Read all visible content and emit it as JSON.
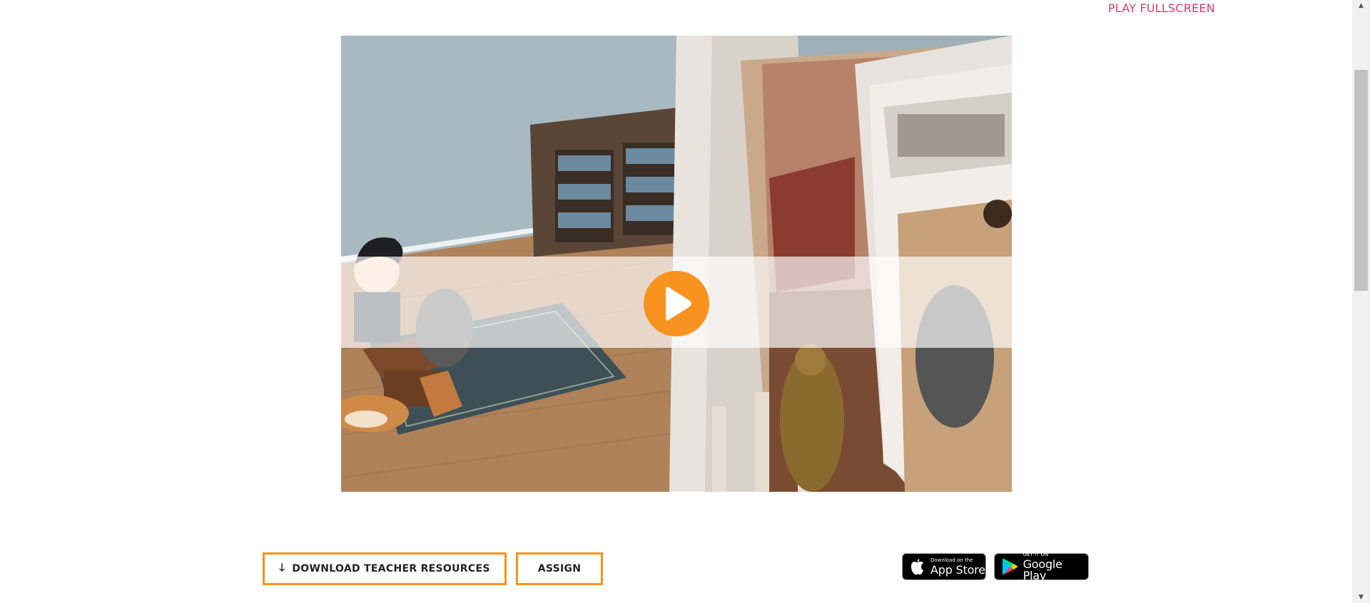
{
  "header": {
    "fullscreen_label": "PLAY FULLSCREEN"
  },
  "actions": {
    "download_label": "DOWNLOAD TEACHER RESOURCES",
    "assign_label": "ASSIGN"
  },
  "stores": {
    "apple_small": "Download on the",
    "apple_big": "App Store",
    "google_small": "GET IT ON",
    "google_big": "Google Play"
  },
  "icons": {
    "play": "play-icon",
    "download": "download-arrow-icon",
    "apple": "apple-icon",
    "google_play": "google-play-icon"
  },
  "colors": {
    "accent": "#f7931e",
    "link": "#d63d6a"
  }
}
